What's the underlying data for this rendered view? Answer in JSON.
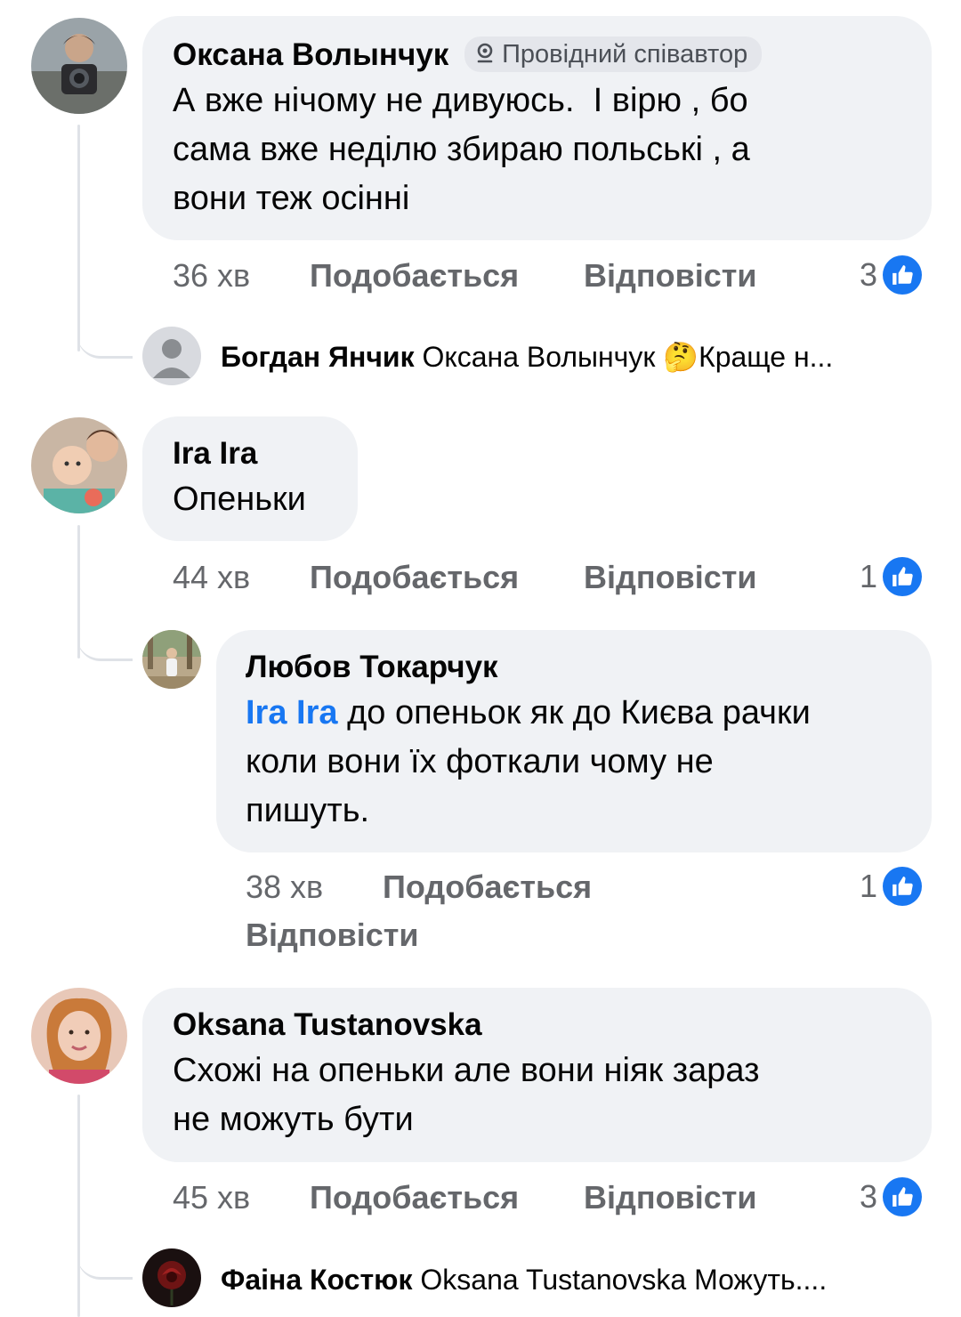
{
  "comments": [
    {
      "author": "Оксана Волынчук",
      "badge": "Провідний співавтор",
      "lines": [
        "А вже нічому не дивуюсь.  І вірю , бо",
        "сама вже неділю збираю польські , а",
        "вони теж осінні"
      ],
      "time": "36 хв",
      "like_label": "Подобається",
      "reply_label": "Відповісти",
      "reaction_count": "3",
      "reply": {
        "author": "Богдан Янчик",
        "text": "Оксана Волынчук 🤔Краще н..."
      }
    },
    {
      "author": "Ira Ira",
      "lines": [
        "Опеньки"
      ],
      "time": "44 хв",
      "like_label": "Подобається",
      "reply_label": "Відповісти",
      "reaction_count": "1",
      "nested": {
        "author": "Любов Токарчук",
        "mention": "Ira Ira",
        "line1": " до опеньок як до Києва рачки",
        "lines": [
          "коли вони їх фоткали чому не",
          "пишуть."
        ],
        "time": "38 хв",
        "like_label": "Подобається",
        "reply_label": "Відповісти",
        "reaction_count": "1"
      }
    },
    {
      "author": "Oksana Tustanovska",
      "lines": [
        "Схожі на опеньки але вони ніяк зараз",
        "не можуть бути"
      ],
      "time": "45 хв",
      "like_label": "Подобається",
      "reply_label": "Відповісти",
      "reaction_count": "3",
      "reply": {
        "author": "Фаіна Костюк",
        "text": "Oksana Tustanovska Можуть...."
      }
    }
  ],
  "colors": {
    "like_blue": "#1877f2",
    "bubble": "#f0f2f5",
    "meta_gray": "#65676b"
  }
}
